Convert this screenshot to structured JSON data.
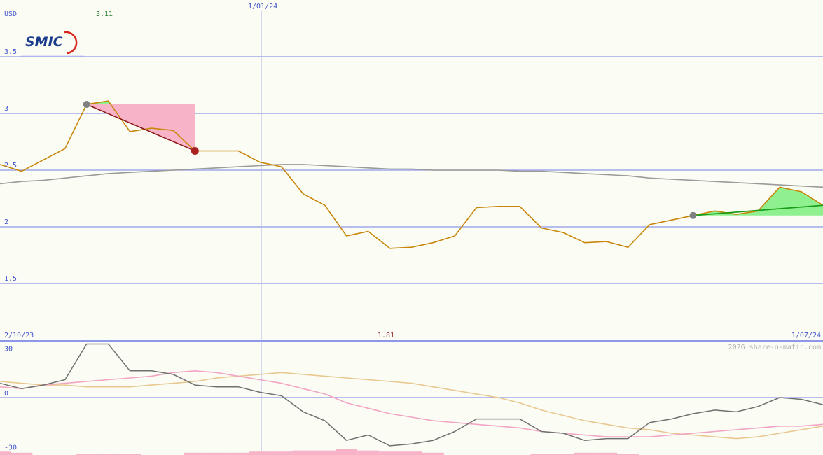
{
  "header": {
    "currency": "USD",
    "max_value": "3.11",
    "year_marker": "1/01/24"
  },
  "logo": {
    "text": "SMIC",
    "brand_color": "#1a3b8c",
    "accent_color": "#d9261c"
  },
  "footer": {
    "start_date": "2/10/23",
    "min_value": "1.81",
    "end_date": "1/07/24",
    "watermark": "2026 share-o-matic.com"
  },
  "colors": {
    "price": "#c8860a",
    "average": "#9a9a9a",
    "grid": "#8f98e8",
    "fall_fill": "#f7b4c8",
    "rise_fill": "#8ef08e",
    "fall_line": "#8b1a1a",
    "rise_line": "#1a9e1a",
    "osc_main": "#707070",
    "osc_pink": "#f2a4c4",
    "osc_tan": "#e8c890",
    "volume": "#f7b4c8",
    "max_label": "#2a7a2a",
    "min_label": "#8b1a1a"
  },
  "chart_data": [
    {
      "type": "line",
      "title": "",
      "ylabel": "USD",
      "ylim": [
        1.0,
        3.5
      ],
      "y_ticks": [
        "3.5",
        "3",
        "2.5",
        "2",
        "1.5"
      ],
      "x_range": [
        "2/10/23",
        "1/07/24"
      ],
      "x_marker": "1/01/24",
      "series": [
        {
          "values": [
            2.55,
            2.49,
            2.59,
            2.69,
            3.08,
            3.11,
            2.84,
            2.87,
            2.85,
            2.67,
            2.67,
            2.67,
            2.57,
            2.53,
            2.29,
            2.19,
            1.92,
            1.96,
            1.81,
            1.82,
            1.86,
            1.92,
            2.17,
            2.18,
            2.18,
            1.99,
            1.95,
            1.86,
            1.87,
            1.82,
            2.02,
            2.06,
            2.1,
            2.14,
            2.11,
            2.14,
            2.35,
            2.31,
            2.19
          ]
        },
        {
          "values": [
            2.38,
            2.4,
            2.41,
            2.43,
            2.45,
            2.47,
            2.48,
            2.49,
            2.5,
            2.51,
            2.52,
            2.53,
            2.54,
            2.55,
            2.55,
            2.54,
            2.53,
            2.52,
            2.51,
            2.51,
            2.5,
            2.5,
            2.5,
            2.5,
            2.49,
            2.49,
            2.48,
            2.47,
            2.46,
            2.45,
            2.43,
            2.42,
            2.41,
            2.4,
            2.39,
            2.38,
            2.37,
            2.36,
            2.35
          ]
        }
      ],
      "annotations": [
        {
          "kind": "fall",
          "from_index": 4,
          "to_index": 9,
          "from_value": 3.08,
          "to_value": 2.67
        },
        {
          "kind": "rise",
          "from_index": 32,
          "to_index": 38,
          "from_value": 2.1,
          "to_value": 2.19
        }
      ]
    },
    {
      "type": "line",
      "title": "",
      "ylim": [
        -30,
        30
      ],
      "y_ticks": [
        "30",
        "0",
        "-30"
      ],
      "series": [
        {
          "values": [
            8,
            5,
            7,
            10,
            30,
            30,
            15,
            15,
            13,
            7,
            6,
            6,
            3,
            1,
            -8,
            -13,
            -24,
            -21,
            -27,
            -26,
            -24,
            -19,
            -12,
            -12,
            -12,
            -19,
            -20,
            -24,
            -23,
            -23,
            -14,
            -12,
            -9,
            -7,
            -8,
            -5,
            0,
            -1,
            -4
          ]
        },
        {
          "values": [
            6,
            5,
            7,
            8,
            9,
            10,
            11,
            12,
            14,
            15,
            14,
            12,
            10,
            8,
            5,
            2,
            -3,
            -6,
            -9,
            -11,
            -13,
            -14,
            -15,
            -16,
            -17,
            -19,
            -20,
            -21,
            -22,
            -22,
            -22,
            -21,
            -20,
            -19,
            -18,
            -17,
            -16,
            -16,
            -15
          ]
        },
        {
          "values": [
            9,
            8,
            7,
            7,
            6,
            6,
            6,
            7,
            8,
            9,
            11,
            12,
            13,
            14,
            13,
            12,
            11,
            10,
            9,
            8,
            6,
            4,
            2,
            0,
            -3,
            -7,
            -10,
            -13,
            -15,
            -17,
            -18,
            -20,
            -21,
            -22,
            -23,
            -22,
            -20,
            -18,
            -16
          ]
        }
      ],
      "volume": [
        3,
        2,
        0,
        0,
        1,
        1,
        1,
        0,
        0,
        2,
        2,
        2,
        3,
        3,
        4,
        4,
        5,
        4,
        3,
        3,
        2,
        0,
        0,
        0,
        0,
        1,
        1,
        2,
        2,
        1,
        0,
        0,
        0,
        0,
        0,
        0,
        0,
        0,
        0
      ]
    }
  ]
}
